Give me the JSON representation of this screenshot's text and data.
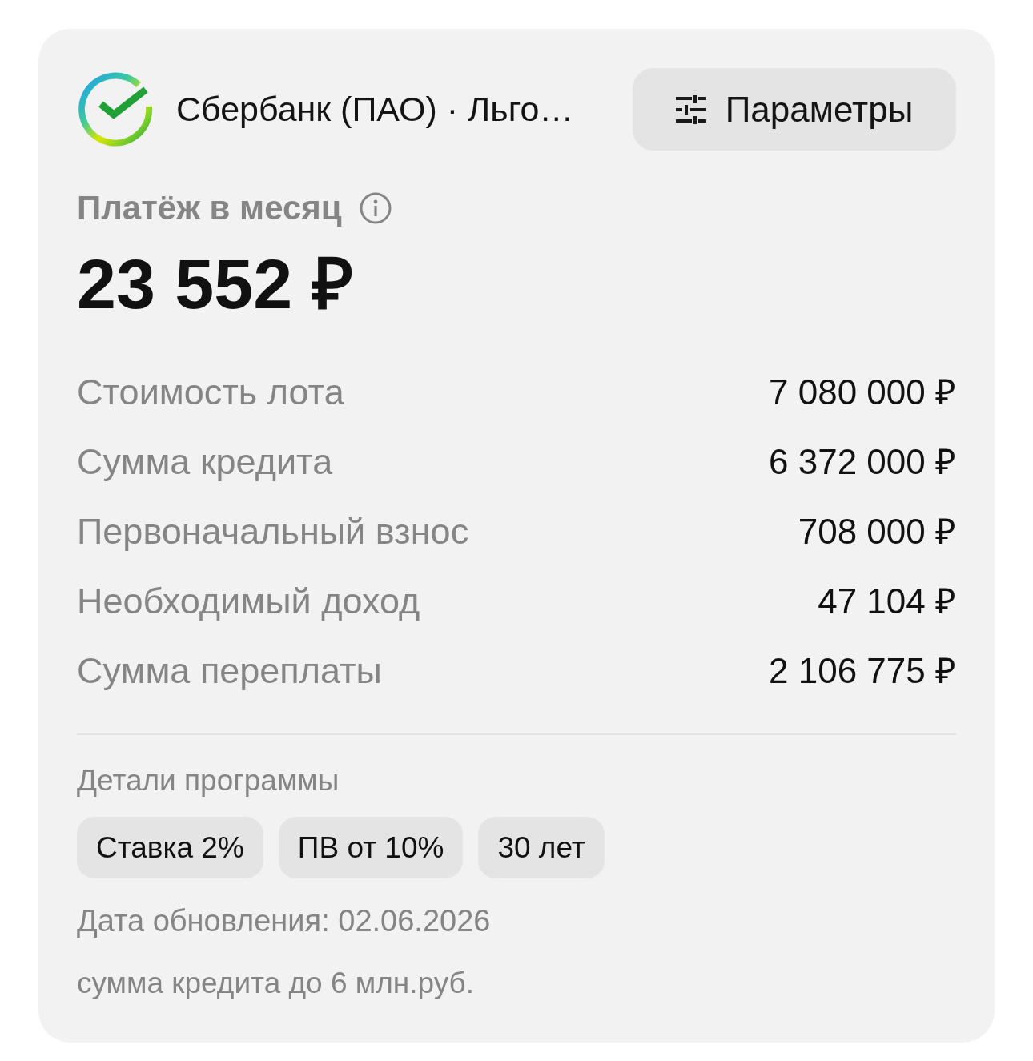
{
  "header": {
    "title": "Сбербанк (ПАО) · Льго…",
    "params_button": {
      "label": "Параметры"
    }
  },
  "payment": {
    "label": "Платёж в месяц",
    "amount": "23 552 ₽"
  },
  "rows": [
    {
      "label": "Стоимость лота",
      "value": "7 080 000 ₽"
    },
    {
      "label": "Сумма кредита",
      "value": "6 372 000 ₽"
    },
    {
      "label": "Первоначальный взнос",
      "value": "708 000 ₽"
    },
    {
      "label": "Необходимый доход",
      "value": "47 104 ₽"
    },
    {
      "label": "Сумма переплаты",
      "value": "2 106 775 ₽"
    }
  ],
  "program": {
    "title": "Детали программы",
    "tags": [
      "Ставка 2%",
      "ПВ от 10%",
      "30 лет"
    ]
  },
  "updated": "Дата обновления: 02.06.2026",
  "note": "сумма кредита до 6 млн.руб."
}
